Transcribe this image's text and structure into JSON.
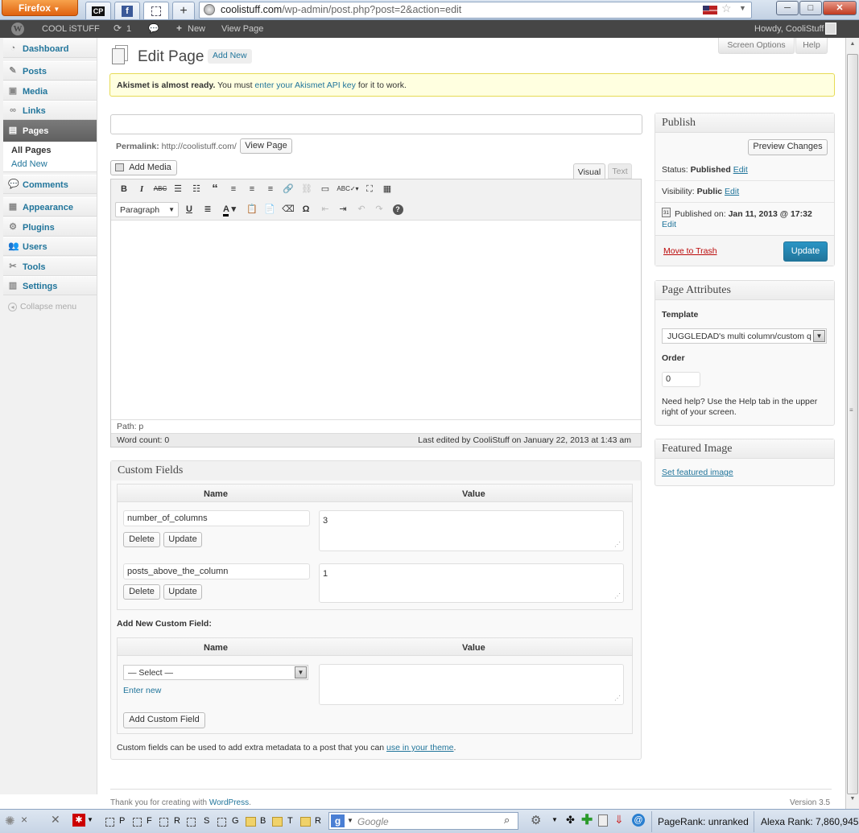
{
  "browser": {
    "menu_label": "Firefox",
    "url_host": "coolistuff.com",
    "url_path": "/wp-admin/post.php?post=2&action=edit",
    "tab_cp": "CP",
    "new_tab": "+"
  },
  "adminbar": {
    "site": "COOL iSTUFF",
    "updates": "1",
    "new": "New",
    "view_page": "View Page",
    "howdy": "Howdy, CooliStuff"
  },
  "sidebar": {
    "items": [
      {
        "label": "Dashboard",
        "icon": "dashboard-icon"
      },
      {
        "label": "Posts",
        "icon": "pin-icon"
      },
      {
        "label": "Media",
        "icon": "media-icon"
      },
      {
        "label": "Links",
        "icon": "links-icon"
      },
      {
        "label": "Pages",
        "icon": "pages-icon"
      },
      {
        "label": "Comments",
        "icon": "comments-icon"
      },
      {
        "label": "Appearance",
        "icon": "appearance-icon"
      },
      {
        "label": "Plugins",
        "icon": "plugins-icon"
      },
      {
        "label": "Users",
        "icon": "users-icon"
      },
      {
        "label": "Tools",
        "icon": "tools-icon"
      },
      {
        "label": "Settings",
        "icon": "settings-icon"
      }
    ],
    "sub_all": "All Pages",
    "sub_add": "Add New",
    "collapse": "Collapse menu"
  },
  "header": {
    "title": "Edit Page",
    "add_new": "Add New",
    "screen_options": "Screen Options",
    "help": "Help"
  },
  "notice": {
    "bold": "Akismet is almost ready.",
    "text": " You must ",
    "link": "enter your Akismet API key",
    "tail": " for it to work."
  },
  "editor": {
    "title_value": "",
    "permalink_label": "Permalink:",
    "permalink_url": "http://coolistuff.com/",
    "view_page": "View Page",
    "add_media": "Add Media",
    "tab_visual": "Visual",
    "tab_text": "Text",
    "format": "Paragraph",
    "path": "Path: p",
    "word_count": "Word count: 0",
    "last_edited": "Last edited by CooliStuff on January 22, 2013 at 1:43 am"
  },
  "custom_fields": {
    "title": "Custom Fields",
    "col_name": "Name",
    "col_value": "Value",
    "rows": [
      {
        "name": "number_of_columns",
        "value": "3"
      },
      {
        "name": "posts_above_the_column",
        "value": "1"
      }
    ],
    "delete": "Delete",
    "update": "Update",
    "add_new_label": "Add New Custom Field:",
    "select_value": "— Select —",
    "enter_new": "Enter new",
    "add_button": "Add Custom Field",
    "footer_text": "Custom fields can be used to add extra metadata to a post that you can ",
    "footer_link": "use in your theme",
    "footer_end": "."
  },
  "publish": {
    "title": "Publish",
    "preview": "Preview Changes",
    "status_label": "Status: ",
    "status_value": "Published",
    "visibility_label": "Visibility: ",
    "visibility_value": "Public",
    "edit": "Edit",
    "published_label": "Published on: ",
    "published_value": "Jan 11, 2013 @ 17:32",
    "trash": "Move to Trash",
    "update": "Update"
  },
  "attributes": {
    "title": "Page Attributes",
    "template_label": "Template",
    "template_value": "JUGGLEDAD's multi column/custom q",
    "order_label": "Order",
    "order_value": "0",
    "help_text_1": "Need help? Use the Help tab in the upper",
    "help_text_2": "right of your screen."
  },
  "featured": {
    "title": "Featured Image",
    "link": "Set featured image"
  },
  "footer": {
    "thanks": "Thank you for creating with ",
    "wp": "WordPress",
    "dot": ".",
    "version": "Version 3.5"
  },
  "statusbar": {
    "letters": [
      "P",
      "F",
      "R",
      "S",
      "G",
      "B",
      "T",
      "R"
    ],
    "search_placeholder": "Google",
    "pagerank": "PageRank: unranked",
    "alexa": "Alexa Rank: 7,860,945"
  },
  "colors": {
    "accent": "#21759b",
    "update_btn": "#2e8ac0",
    "notice_bg": "#ffffe0",
    "trash": "#bc0b0b"
  }
}
